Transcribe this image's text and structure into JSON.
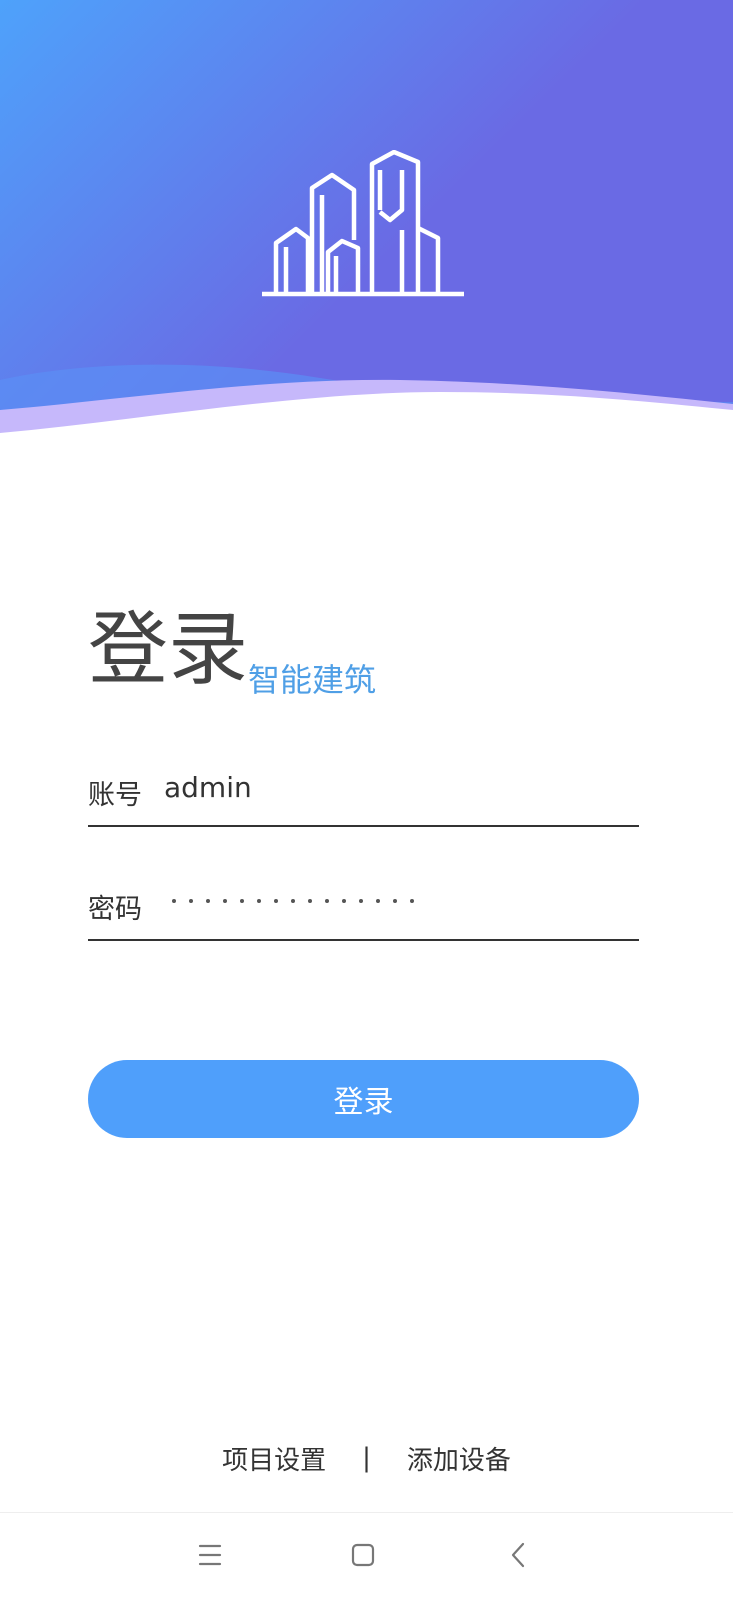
{
  "colors": {
    "header_gradient_start": "#4ea2fb",
    "header_gradient_end": "#6a6ae4",
    "wave_accent": "#c6b8fb",
    "subtitle": "#4f9fe6",
    "button": "#4f9ffb",
    "text": "#333333"
  },
  "header": {
    "logo_icon": "buildings-icon"
  },
  "login": {
    "title": "登录",
    "subtitle": "智能建筑",
    "account_label": "账号",
    "account_value": "admin",
    "password_label": "密码",
    "password_mask_length": 15,
    "button_label": "登录"
  },
  "footer": {
    "project_settings": "项目设置",
    "separator": "|",
    "add_device": "添加设备"
  },
  "navbar": {
    "icons": [
      "menu-icon",
      "home-square-icon",
      "back-chevron-icon"
    ]
  }
}
